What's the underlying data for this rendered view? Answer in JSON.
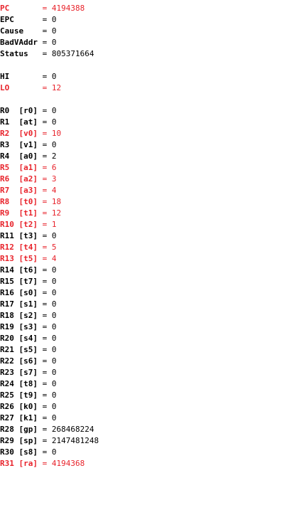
{
  "colors": {
    "text": "#000000",
    "changed": "#e8232b",
    "background": "#ffffff"
  },
  "special": [
    {
      "name": "PC      ",
      "value": "4194388",
      "changed": true
    },
    {
      "name": "EPC     ",
      "value": "0",
      "changed": false
    },
    {
      "name": "Cause   ",
      "value": "0",
      "changed": false
    },
    {
      "name": "BadVAddr",
      "value": "0",
      "changed": false
    },
    {
      "name": "Status  ",
      "value": "805371664",
      "changed": false
    }
  ],
  "hilo": [
    {
      "name": "HI      ",
      "value": "0",
      "changed": false
    },
    {
      "name": "LO      ",
      "value": "12",
      "changed": true
    }
  ],
  "registers": [
    {
      "name": "R0 ",
      "alias": " [r0]",
      "value": "0",
      "changed": false
    },
    {
      "name": "R1 ",
      "alias": " [at]",
      "value": "0",
      "changed": false
    },
    {
      "name": "R2 ",
      "alias": " [v0]",
      "value": "10",
      "changed": true
    },
    {
      "name": "R3 ",
      "alias": " [v1]",
      "value": "0",
      "changed": false
    },
    {
      "name": "R4 ",
      "alias": " [a0]",
      "value": "2",
      "changed": false
    },
    {
      "name": "R5 ",
      "alias": " [a1]",
      "value": "6",
      "changed": true
    },
    {
      "name": "R6 ",
      "alias": " [a2]",
      "value": "3",
      "changed": true
    },
    {
      "name": "R7 ",
      "alias": " [a3]",
      "value": "4",
      "changed": true
    },
    {
      "name": "R8 ",
      "alias": " [t0]",
      "value": "18",
      "changed": true
    },
    {
      "name": "R9 ",
      "alias": " [t1]",
      "value": "12",
      "changed": true
    },
    {
      "name": "R10",
      "alias": " [t2]",
      "value": "1",
      "changed": true
    },
    {
      "name": "R11",
      "alias": " [t3]",
      "value": "0",
      "changed": false
    },
    {
      "name": "R12",
      "alias": " [t4]",
      "value": "5",
      "changed": true
    },
    {
      "name": "R13",
      "alias": " [t5]",
      "value": "4",
      "changed": true
    },
    {
      "name": "R14",
      "alias": " [t6]",
      "value": "0",
      "changed": false
    },
    {
      "name": "R15",
      "alias": " [t7]",
      "value": "0",
      "changed": false
    },
    {
      "name": "R16",
      "alias": " [s0]",
      "value": "0",
      "changed": false
    },
    {
      "name": "R17",
      "alias": " [s1]",
      "value": "0",
      "changed": false
    },
    {
      "name": "R18",
      "alias": " [s2]",
      "value": "0",
      "changed": false
    },
    {
      "name": "R19",
      "alias": " [s3]",
      "value": "0",
      "changed": false
    },
    {
      "name": "R20",
      "alias": " [s4]",
      "value": "0",
      "changed": false
    },
    {
      "name": "R21",
      "alias": " [s5]",
      "value": "0",
      "changed": false
    },
    {
      "name": "R22",
      "alias": " [s6]",
      "value": "0",
      "changed": false
    },
    {
      "name": "R23",
      "alias": " [s7]",
      "value": "0",
      "changed": false
    },
    {
      "name": "R24",
      "alias": " [t8]",
      "value": "0",
      "changed": false
    },
    {
      "name": "R25",
      "alias": " [t9]",
      "value": "0",
      "changed": false
    },
    {
      "name": "R26",
      "alias": " [k0]",
      "value": "0",
      "changed": false
    },
    {
      "name": "R27",
      "alias": " [k1]",
      "value": "0",
      "changed": false
    },
    {
      "name": "R28",
      "alias": " [gp]",
      "value": "268468224",
      "changed": false
    },
    {
      "name": "R29",
      "alias": " [sp]",
      "value": "2147481248",
      "changed": false
    },
    {
      "name": "R30",
      "alias": " [s8]",
      "value": "0",
      "changed": false
    },
    {
      "name": "R31",
      "alias": " [ra]",
      "value": "4194368",
      "changed": true
    }
  ]
}
